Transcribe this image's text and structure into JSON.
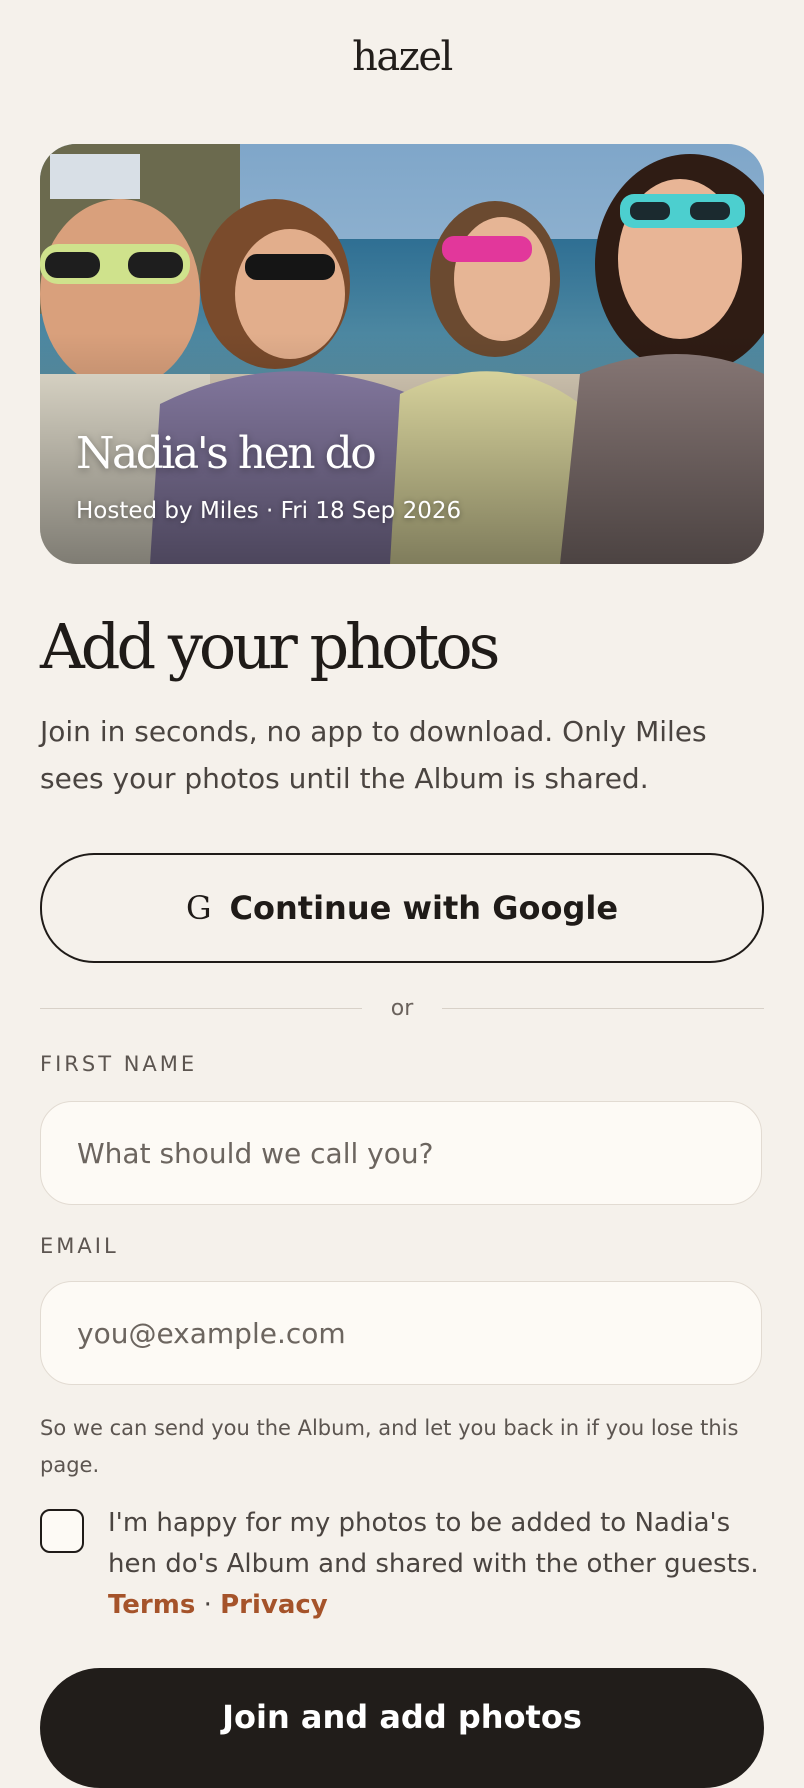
{
  "app": {
    "logo": "hazel"
  },
  "event": {
    "title": "Nadia's hen do",
    "subtitle": "Hosted by Miles · Fri 18 Sep 2026"
  },
  "main": {
    "heading": "Add your photos",
    "intro": "Join in seconds, no app to download. Only Miles sees your photos until the Album is shared."
  },
  "auth": {
    "google_label": "Continue with Google",
    "google_icon": "google-g-icon",
    "divider_text": "or"
  },
  "form": {
    "first_name_label": "FIRST NAME",
    "first_name_placeholder": "What should we call you?",
    "first_name_value": "",
    "email_label": "EMAIL",
    "email_placeholder": "you@example.com",
    "email_value": "",
    "hint": "So we can send you the Album, and let you back in if you lose this page.",
    "consent_checked": false,
    "consent_text": "I'm happy for my photos to be added to Nadia's hen do's Album and shared with the other guests. ",
    "terms_label": "Terms",
    "separator": " · ",
    "privacy_label": "Privacy",
    "submit_label": "Join and add photos"
  },
  "colors": {
    "background": "#f5f1eb",
    "text_dark": "#1f1b18",
    "accent_link": "#a5532a",
    "button_dark": "#211d1a"
  }
}
